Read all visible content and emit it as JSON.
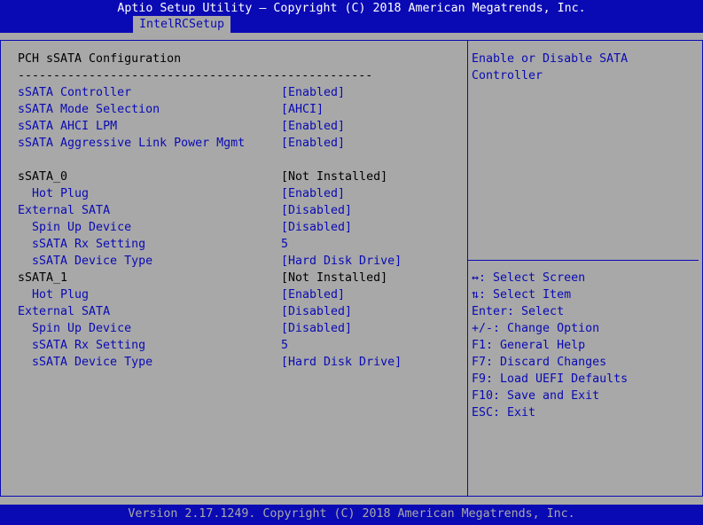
{
  "header": {
    "title": "Aptio Setup Utility – Copyright (C) 2018 American Megatrends, Inc.",
    "tab": "IntelRCSetup"
  },
  "page": {
    "heading": "PCH sSATA Configuration",
    "separator": "--------------------------------------------------"
  },
  "settings": [
    {
      "label": "sSATA Controller",
      "value": "[Enabled]"
    },
    {
      "label": "sSATA Mode Selection",
      "value": "[AHCI]"
    },
    {
      "label": "sSATA AHCI LPM",
      "value": "[Enabled]"
    },
    {
      "label": "sSATA Aggressive Link Power Mgmt",
      "value": "[Enabled]"
    },
    {
      "label": "sSATA_0",
      "value": "[Not Installed]"
    },
    {
      "label": "Hot Plug",
      "value": "[Enabled]"
    },
    {
      "label": "External SATA",
      "value": "[Disabled]"
    },
    {
      "label": "Spin Up Device",
      "value": "[Disabled]"
    },
    {
      "label": "sSATA Rx Setting",
      "value": "5"
    },
    {
      "label": "sSATA Device Type",
      "value": "[Hard Disk Drive]"
    },
    {
      "label": "sSATA_1",
      "value": "[Not Installed]"
    },
    {
      "label": "Hot Plug",
      "value": "[Enabled]"
    },
    {
      "label": "External SATA",
      "value": "[Disabled]"
    },
    {
      "label": "Spin Up Device",
      "value": "[Disabled]"
    },
    {
      "label": "sSATA Rx Setting",
      "value": "5"
    },
    {
      "label": "sSATA Device Type",
      "value": "[Hard Disk Drive]"
    }
  ],
  "help": {
    "lines": [
      "Enable or Disable SATA",
      "Controller"
    ]
  },
  "keys": [
    "↔: Select Screen",
    "⇅: Select Item",
    "Enter: Select",
    "+/-: Change Option",
    "F1: General Help",
    "F7: Discard Changes",
    "F9: Load UEFI Defaults",
    "F10: Save and Exit",
    "ESC: Exit"
  ],
  "footer": {
    "text": "Version 2.17.1249. Copyright (C) 2018 American Megatrends, Inc."
  },
  "colors": {
    "bios_blue": "#0a0ab4",
    "bios_gray": "#a8a8a8",
    "text_black": "#000000",
    "text_white": "#ffffff"
  }
}
